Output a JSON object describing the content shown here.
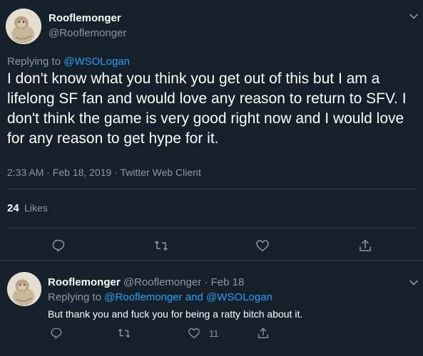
{
  "main_tweet": {
    "display_name": "Rooflemonger",
    "handle": "@Rooflemonger",
    "replying_prefix": "Replying to",
    "replying_to": "@WSOLogan",
    "text": "I don't know what you think you get out of this but I am a lifelong SF fan and would love any reason to return to SFV. I don't think the game is very good right now and I would love for any reason to get hype for it.",
    "meta": "2:33 AM · Feb 18, 2019 · Twitter Web Client",
    "likes_count": "24",
    "likes_label": "Likes",
    "actions": [
      "reply-icon",
      "retweet-icon",
      "like-icon",
      "share-icon"
    ]
  },
  "reply_tweet": {
    "display_name": "Rooflemonger",
    "handle": "@Rooflemonger",
    "separator": "·",
    "date": "Feb 18",
    "replying_prefix": "Replying to",
    "replying_to": "@Rooflemonger and @WSOLogan",
    "text": "But thank you and fuck you for being a ratty bitch about it.",
    "like_count": "11",
    "actions": [
      "reply-icon",
      "retweet-icon",
      "like-icon",
      "share-icon"
    ]
  },
  "colors": {
    "background": "#15202b",
    "primary_text": "#ffffff",
    "secondary_text": "#8899a6",
    "accent": "#1da1f2",
    "divider": "#38444d"
  }
}
